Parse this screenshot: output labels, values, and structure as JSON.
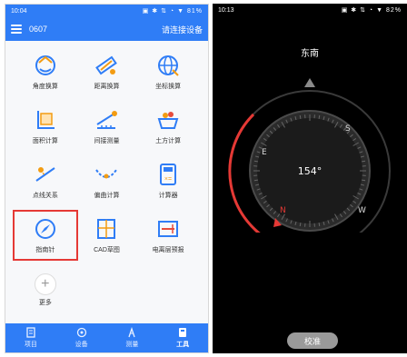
{
  "left_phone": {
    "statusbar": {
      "time": "10:04",
      "indicators": "▣ ✱ ⇅ ◔ ▼ 81%"
    },
    "appbar": {
      "title": "0607",
      "connect_label": "请连接设备"
    },
    "tiles": [
      {
        "label": "角度换算",
        "icon": "angle-convert-icon"
      },
      {
        "label": "距离换算",
        "icon": "distance-convert-icon"
      },
      {
        "label": "坐标换算",
        "icon": "coordinate-convert-icon"
      },
      {
        "label": "面积计算",
        "icon": "area-calc-icon"
      },
      {
        "label": "间接测量",
        "icon": "indirect-measure-icon"
      },
      {
        "label": "土方计算",
        "icon": "earthwork-calc-icon"
      },
      {
        "label": "点线关系",
        "icon": "point-line-icon"
      },
      {
        "label": "偏曲计算",
        "icon": "curve-calc-icon"
      },
      {
        "label": "计算器",
        "icon": "calculator-icon"
      },
      {
        "label": "指南针",
        "icon": "compass-icon"
      },
      {
        "label": "CAD草图",
        "icon": "cad-sketch-icon"
      },
      {
        "label": "电离层预报",
        "icon": "ionosphere-icon"
      },
      {
        "label": "更多",
        "icon": "plus-icon"
      }
    ],
    "bottom_nav": [
      {
        "label": "项目",
        "icon": "project-icon"
      },
      {
        "label": "设备",
        "icon": "device-icon"
      },
      {
        "label": "测量",
        "icon": "survey-icon"
      },
      {
        "label": "工具",
        "icon": "tools-icon"
      }
    ],
    "colors": {
      "primary": "#2f7df6",
      "selected_outline": "#e53935"
    }
  },
  "right_phone": {
    "statusbar": {
      "time": "10:13",
      "indicators": "▣ ✱ ⇅ ◔ ▼ 82%"
    },
    "direction_label": "东南",
    "heading": "154°",
    "heading_deg": 154,
    "cardinals": {
      "n": "N",
      "e": "E",
      "s": "S",
      "w": "W"
    },
    "calibrate_label": "校准",
    "colors": {
      "heading_arc": "#e53935"
    }
  }
}
